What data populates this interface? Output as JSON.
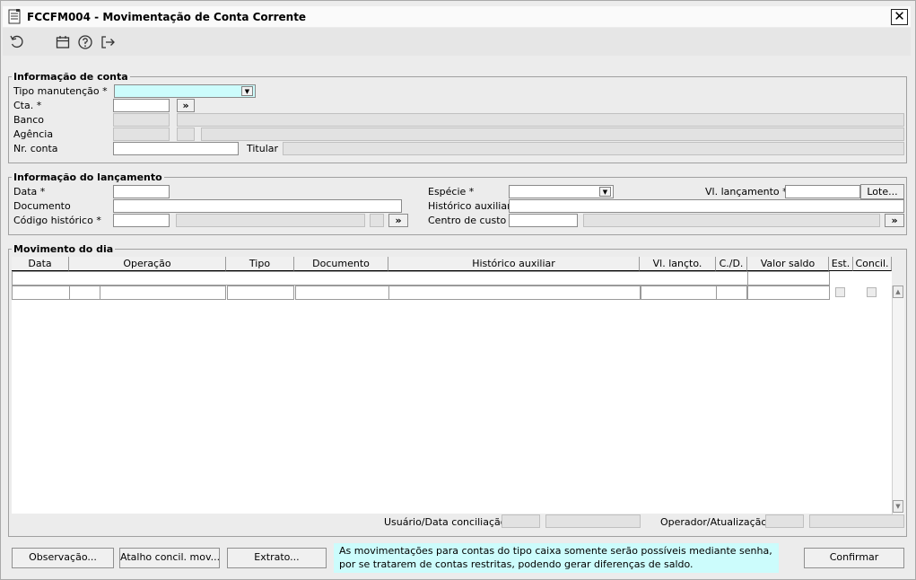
{
  "window": {
    "title": "FCCFM004 - Movimentação de Conta Corrente",
    "close_label": "✕"
  },
  "toolbar": {
    "icons": [
      "refresh-icon",
      "calendar-icon",
      "help-icon",
      "exit-icon"
    ]
  },
  "conta": {
    "legend": "Informação de conta",
    "tipo_label": "Tipo manutenção *",
    "cta_label": "Cta. *",
    "cta_btn": "»",
    "banco_label": "Banco",
    "agencia_label": "Agência",
    "nr_label": "Nr. conta",
    "titular_label": "Titular"
  },
  "lancamento": {
    "legend": "Informação do lançamento",
    "data_label": "Data *",
    "documento_label": "Documento",
    "codigo_label": "Código histórico *",
    "codigo_btn": "»",
    "especie_label": "Espécie *",
    "historico_label": "Histórico auxiliar",
    "centro_label": "Centro de custo",
    "centro_btn": "»",
    "vl_label": "Vl. lançamento *",
    "lote_label": "Lote..."
  },
  "movimento": {
    "legend": "Movimento do dia",
    "columns": [
      "Data",
      "Operação",
      "Tipo",
      "Documento",
      "Histórico auxiliar",
      "Vl. lançto.",
      "C./D.",
      "Valor saldo",
      "Est.",
      "Concil."
    ],
    "usuario_label": "Usuário/Data conciliação",
    "operador_label": "Operador/Atualização"
  },
  "footer": {
    "observacao": "Observação...",
    "atalho": "Atalho concil. mov...",
    "extrato": "Extrato...",
    "note": "As movimentações para contas do tipo caixa somente serão possíveis mediante senha, por se tratarem de contas restritas, podendo gerar diferenças de saldo.",
    "confirmar": "Confirmar"
  },
  "colors": {
    "required_field": "#ccfcfc",
    "note_bg": "#ccfcfc",
    "window_bg": "#ececec"
  }
}
